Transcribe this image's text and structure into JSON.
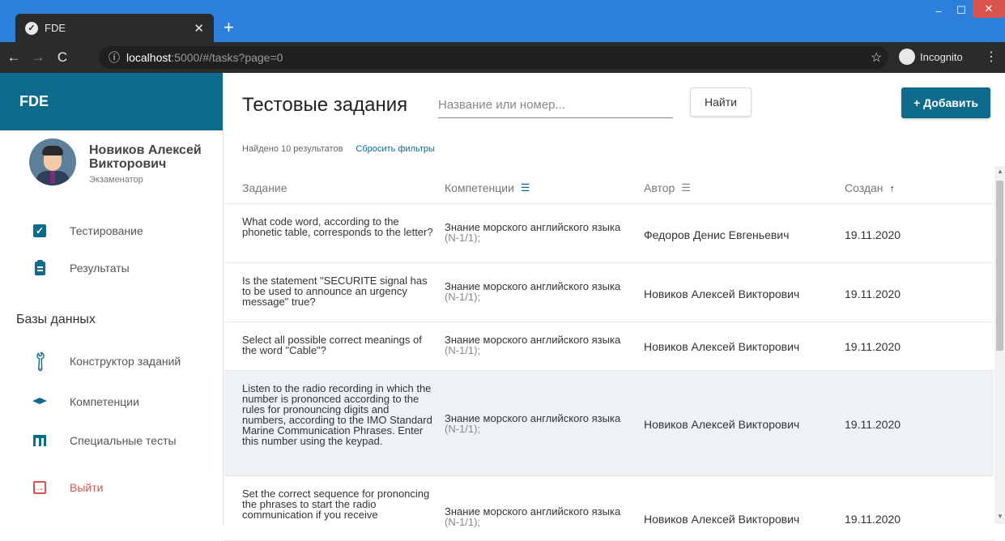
{
  "browser": {
    "tab_title": "FDE",
    "new_tab": "+",
    "url_host": "localhost",
    "url_rest": ":5000/#/tasks?page=0",
    "incognito_label": "Incognito"
  },
  "sidebar": {
    "brand": "FDE",
    "user_name": "Новиков Алексей Викторович",
    "user_role": "Экзаменатор",
    "items": [
      {
        "label": "Тестирование",
        "icon": "checkbox-icon"
      },
      {
        "label": "Результаты",
        "icon": "clipboard-icon"
      }
    ],
    "section_title": "Базы данных",
    "db_items": [
      {
        "label": "Конструктор заданий",
        "icon": "wrench-icon"
      },
      {
        "label": "Компетенции",
        "icon": "graduation-cap-icon"
      },
      {
        "label": "Специальные тесты",
        "icon": "table-icon"
      }
    ],
    "exit_label": "Выйти"
  },
  "main": {
    "title": "Тестовые задания",
    "search_placeholder": "Название или номер...",
    "find_label": "Найти",
    "add_label": "+ Добавить",
    "results_text": "Найдено 10 результатов",
    "reset_label": "Сбросить фильтры",
    "columns": [
      "Задание",
      "Компетенции",
      "Автор",
      "Создан"
    ],
    "rows": [
      {
        "task": "What code word, according to the phonetic table, corresponds to the letter?",
        "competence": "Знание морского английского языка",
        "code": "(N-1/1);",
        "author": "Федоров Денис Евгеньевич",
        "date": "19.11.2020"
      },
      {
        "task": "Is the statement \"SECURITE signal has to be used to announce an urgency message\" true?",
        "competence": "Знание морского английского языка",
        "code": "(N-1/1);",
        "author": "Новиков Алексей Викторович",
        "date": "19.11.2020"
      },
      {
        "task": "Select all possible correct meanings of the word \"Cable\"?",
        "competence": "Знание морского английского языка",
        "code": "(N-1/1);",
        "author": "Новиков Алексей Викторович",
        "date": "19.11.2020"
      },
      {
        "task": "Listen to the radio recording in which the number is prononced according to the rules for pronouncing digits and numbers, according to the IMO Standard Marine Communication Phrases. Enter this number using the keypad.",
        "competence": "Знание морского английского языка",
        "code": "(N-1/1);",
        "author": "Новиков Алексей Викторович",
        "date": "19.11.2020"
      },
      {
        "task": "Set the correct sequence for prononcing the phrases to start the radio communication if you receive",
        "competence": "Знание морского английского языка",
        "code": "(N-1/1);",
        "author": "Новиков Алексей Викторович",
        "date": "19.11.2020"
      }
    ]
  },
  "colors": {
    "accent": "#0e6b8c",
    "danger": "#d9534f",
    "chrome_tabbar": "#2d7fdc"
  }
}
